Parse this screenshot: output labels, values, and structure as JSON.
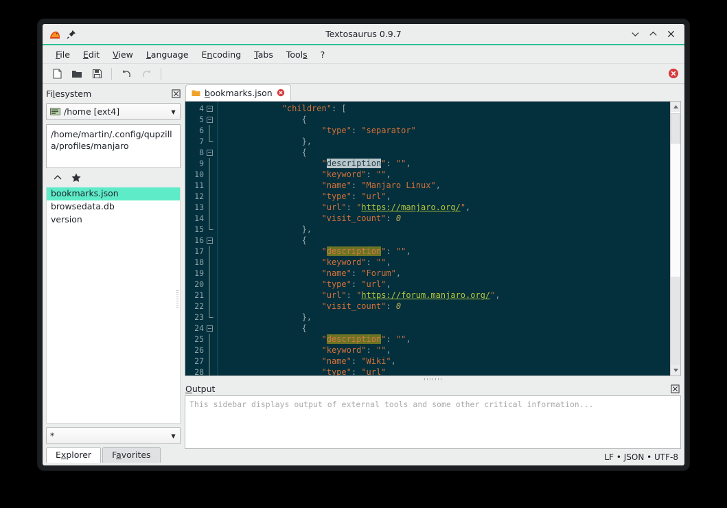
{
  "window": {
    "title": "Textosaurus 0.9.7",
    "app_icon": "dinosaur-icon",
    "pin_icon": "pin-icon",
    "controls": [
      {
        "name": "minimize",
        "glyph": "chevron-down-icon"
      },
      {
        "name": "maximize",
        "glyph": "chevron-up-icon"
      },
      {
        "name": "close",
        "glyph": "close-x-icon"
      }
    ],
    "accent_color": "#2bbf96",
    "frame_color": "#1b1f22",
    "chrome_color": "#eceded"
  },
  "menu": [
    {
      "label": "File",
      "accel": "F"
    },
    {
      "label": "Edit",
      "accel": "E"
    },
    {
      "label": "View",
      "accel": "V"
    },
    {
      "label": "Language",
      "accel": "L"
    },
    {
      "label": "Encoding",
      "accel": "n"
    },
    {
      "label": "Tabs",
      "accel": "T"
    },
    {
      "label": "Tools",
      "accel": "s"
    },
    {
      "label": "?",
      "accel": ""
    }
  ],
  "toolbar": {
    "buttons": [
      {
        "name": "new-file-button",
        "icon": "new-file-icon",
        "enabled": true
      },
      {
        "name": "open-file-button",
        "icon": "open-folder-icon",
        "enabled": true
      },
      {
        "name": "save-file-button",
        "icon": "save-floppy-icon",
        "enabled": true
      },
      {
        "name": "undo-button",
        "icon": "undo-arrow-icon",
        "enabled": true
      },
      {
        "name": "redo-button",
        "icon": "redo-arrow-icon",
        "enabled": false
      }
    ],
    "error_indicator": {
      "name": "error-indicator",
      "icon": "red-x-circle-icon",
      "color": "#d93a3a"
    }
  },
  "sidebar": {
    "title": "Filesystem",
    "title_accel": "l",
    "close_icon": "panel-close-icon",
    "drive_combo": {
      "value": "/home [ext4]",
      "icon": "drive-icon"
    },
    "path": "/home/martin/.config/qupzilla/profiles/manjaro",
    "nav": [
      {
        "name": "parent-directory-button",
        "icon": "chevron-up-icon"
      },
      {
        "name": "add-favorite-button",
        "icon": "star-icon"
      }
    ],
    "files": [
      {
        "name": "bookmarks.json",
        "selected": true
      },
      {
        "name": "browsedata.db",
        "selected": false
      },
      {
        "name": "version",
        "selected": false
      }
    ],
    "selection_color": "#5eecc8",
    "filter": {
      "value": "*",
      "placeholder": "*"
    },
    "tabs": [
      {
        "label": "Explorer",
        "accel": "x",
        "active": true
      },
      {
        "label": "Favorites",
        "accel": "a",
        "active": false
      }
    ]
  },
  "editor": {
    "tab": {
      "label": "bookmarks.json",
      "accel": "b",
      "file_icon": "json-file-icon",
      "close_icon": "tab-close-icon",
      "modified": true
    },
    "background": "#03303c",
    "first_line": 4,
    "find_highlight_color": "#6b7324",
    "selection_highlight_color": "#b9c6cb",
    "lines": [
      {
        "n": 4,
        "fold": "minus",
        "tokens": [
          {
            "t": "            ",
            "c": "p"
          },
          {
            "t": "\"children\"",
            "c": "k"
          },
          {
            "t": ": [",
            "c": "p"
          }
        ]
      },
      {
        "n": 5,
        "fold": "minus",
        "tokens": [
          {
            "t": "                {",
            "c": "p"
          }
        ]
      },
      {
        "n": 6,
        "fold": "line",
        "tokens": [
          {
            "t": "                    ",
            "c": "p"
          },
          {
            "t": "\"type\"",
            "c": "k"
          },
          {
            "t": ": ",
            "c": "p"
          },
          {
            "t": "\"separator\"",
            "c": "s"
          }
        ]
      },
      {
        "n": 7,
        "fold": "end",
        "tokens": [
          {
            "t": "                },",
            "c": "p"
          }
        ]
      },
      {
        "n": 8,
        "fold": "minus",
        "tokens": [
          {
            "t": "                {",
            "c": "p"
          }
        ]
      },
      {
        "n": 9,
        "fold": "line",
        "tokens": [
          {
            "t": "                    ",
            "c": "p"
          },
          {
            "t": "\"",
            "c": "k"
          },
          {
            "t": "description",
            "c": "sel"
          },
          {
            "t": "\"",
            "c": "k"
          },
          {
            "t": ": ",
            "c": "p"
          },
          {
            "t": "\"\"",
            "c": "s"
          },
          {
            "t": ",",
            "c": "p"
          }
        ]
      },
      {
        "n": 10,
        "fold": "line",
        "tokens": [
          {
            "t": "                    ",
            "c": "p"
          },
          {
            "t": "\"keyword\"",
            "c": "k"
          },
          {
            "t": ": ",
            "c": "p"
          },
          {
            "t": "\"\"",
            "c": "s"
          },
          {
            "t": ",",
            "c": "p"
          }
        ]
      },
      {
        "n": 11,
        "fold": "line",
        "tokens": [
          {
            "t": "                    ",
            "c": "p"
          },
          {
            "t": "\"name\"",
            "c": "k"
          },
          {
            "t": ": ",
            "c": "p"
          },
          {
            "t": "\"Manjaro Linux\"",
            "c": "s"
          },
          {
            "t": ",",
            "c": "p"
          }
        ]
      },
      {
        "n": 12,
        "fold": "line",
        "tokens": [
          {
            "t": "                    ",
            "c": "p"
          },
          {
            "t": "\"type\"",
            "c": "k"
          },
          {
            "t": ": ",
            "c": "p"
          },
          {
            "t": "\"url\"",
            "c": "s"
          },
          {
            "t": ",",
            "c": "p"
          }
        ]
      },
      {
        "n": 13,
        "fold": "line",
        "tokens": [
          {
            "t": "                    ",
            "c": "p"
          },
          {
            "t": "\"url\"",
            "c": "k"
          },
          {
            "t": ": ",
            "c": "p"
          },
          {
            "t": "\"",
            "c": "s"
          },
          {
            "t": "https://manjaro.org/",
            "c": "u"
          },
          {
            "t": "\"",
            "c": "s"
          },
          {
            "t": ",",
            "c": "p"
          }
        ]
      },
      {
        "n": 14,
        "fold": "line",
        "tokens": [
          {
            "t": "                    ",
            "c": "p"
          },
          {
            "t": "\"visit_count\"",
            "c": "k"
          },
          {
            "t": ": ",
            "c": "p"
          },
          {
            "t": "0",
            "c": "n"
          }
        ]
      },
      {
        "n": 15,
        "fold": "end",
        "tokens": [
          {
            "t": "                },",
            "c": "p"
          }
        ]
      },
      {
        "n": 16,
        "fold": "minus",
        "tokens": [
          {
            "t": "                {",
            "c": "p"
          }
        ]
      },
      {
        "n": 17,
        "fold": "line",
        "tokens": [
          {
            "t": "                    ",
            "c": "p"
          },
          {
            "t": "\"",
            "c": "k"
          },
          {
            "t": "description",
            "c": "find"
          },
          {
            "t": "\"",
            "c": "k"
          },
          {
            "t": ": ",
            "c": "p"
          },
          {
            "t": "\"\"",
            "c": "s"
          },
          {
            "t": ",",
            "c": "p"
          }
        ]
      },
      {
        "n": 18,
        "fold": "line",
        "tokens": [
          {
            "t": "                    ",
            "c": "p"
          },
          {
            "t": "\"keyword\"",
            "c": "k"
          },
          {
            "t": ": ",
            "c": "p"
          },
          {
            "t": "\"\"",
            "c": "s"
          },
          {
            "t": ",",
            "c": "p"
          }
        ]
      },
      {
        "n": 19,
        "fold": "line",
        "tokens": [
          {
            "t": "                    ",
            "c": "p"
          },
          {
            "t": "\"name\"",
            "c": "k"
          },
          {
            "t": ": ",
            "c": "p"
          },
          {
            "t": "\"Forum\"",
            "c": "s"
          },
          {
            "t": ",",
            "c": "p"
          }
        ]
      },
      {
        "n": 20,
        "fold": "line",
        "tokens": [
          {
            "t": "                    ",
            "c": "p"
          },
          {
            "t": "\"type\"",
            "c": "k"
          },
          {
            "t": ": ",
            "c": "p"
          },
          {
            "t": "\"url\"",
            "c": "s"
          },
          {
            "t": ",",
            "c": "p"
          }
        ]
      },
      {
        "n": 21,
        "fold": "line",
        "tokens": [
          {
            "t": "                    ",
            "c": "p"
          },
          {
            "t": "\"url\"",
            "c": "k"
          },
          {
            "t": ": ",
            "c": "p"
          },
          {
            "t": "\"",
            "c": "s"
          },
          {
            "t": "https://forum.manjaro.org/",
            "c": "u"
          },
          {
            "t": "\"",
            "c": "s"
          },
          {
            "t": ",",
            "c": "p"
          }
        ]
      },
      {
        "n": 22,
        "fold": "line",
        "tokens": [
          {
            "t": "                    ",
            "c": "p"
          },
          {
            "t": "\"visit_count\"",
            "c": "k"
          },
          {
            "t": ": ",
            "c": "p"
          },
          {
            "t": "0",
            "c": "n"
          }
        ]
      },
      {
        "n": 23,
        "fold": "end",
        "tokens": [
          {
            "t": "                },",
            "c": "p"
          }
        ]
      },
      {
        "n": 24,
        "fold": "minus",
        "tokens": [
          {
            "t": "                {",
            "c": "p"
          }
        ]
      },
      {
        "n": 25,
        "fold": "line",
        "tokens": [
          {
            "t": "                    ",
            "c": "p"
          },
          {
            "t": "\"",
            "c": "k"
          },
          {
            "t": "description",
            "c": "find"
          },
          {
            "t": "\"",
            "c": "k"
          },
          {
            "t": ": ",
            "c": "p"
          },
          {
            "t": "\"\"",
            "c": "s"
          },
          {
            "t": ",",
            "c": "p"
          }
        ]
      },
      {
        "n": 26,
        "fold": "line",
        "tokens": [
          {
            "t": "                    ",
            "c": "p"
          },
          {
            "t": "\"keyword\"",
            "c": "k"
          },
          {
            "t": ": ",
            "c": "p"
          },
          {
            "t": "\"\"",
            "c": "s"
          },
          {
            "t": ",",
            "c": "p"
          }
        ]
      },
      {
        "n": 27,
        "fold": "line",
        "tokens": [
          {
            "t": "                    ",
            "c": "p"
          },
          {
            "t": "\"name\"",
            "c": "k"
          },
          {
            "t": ": ",
            "c": "p"
          },
          {
            "t": "\"Wiki\"",
            "c": "s"
          },
          {
            "t": ",",
            "c": "p"
          }
        ]
      },
      {
        "n": 28,
        "fold": "line",
        "tokens": [
          {
            "t": "                    ",
            "c": "p"
          },
          {
            "t": "\"type\"",
            "c": "k"
          },
          {
            "t": ": ",
            "c": "p"
          },
          {
            "t": "\"url\"",
            "c": "s"
          }
        ]
      }
    ]
  },
  "output": {
    "title": "Output",
    "title_accel": "O",
    "close_icon": "panel-close-icon",
    "placeholder": "This sidebar displays output of external tools and some other critical information..."
  },
  "status_bar": {
    "text": "LF • JSON • UTF-8"
  }
}
